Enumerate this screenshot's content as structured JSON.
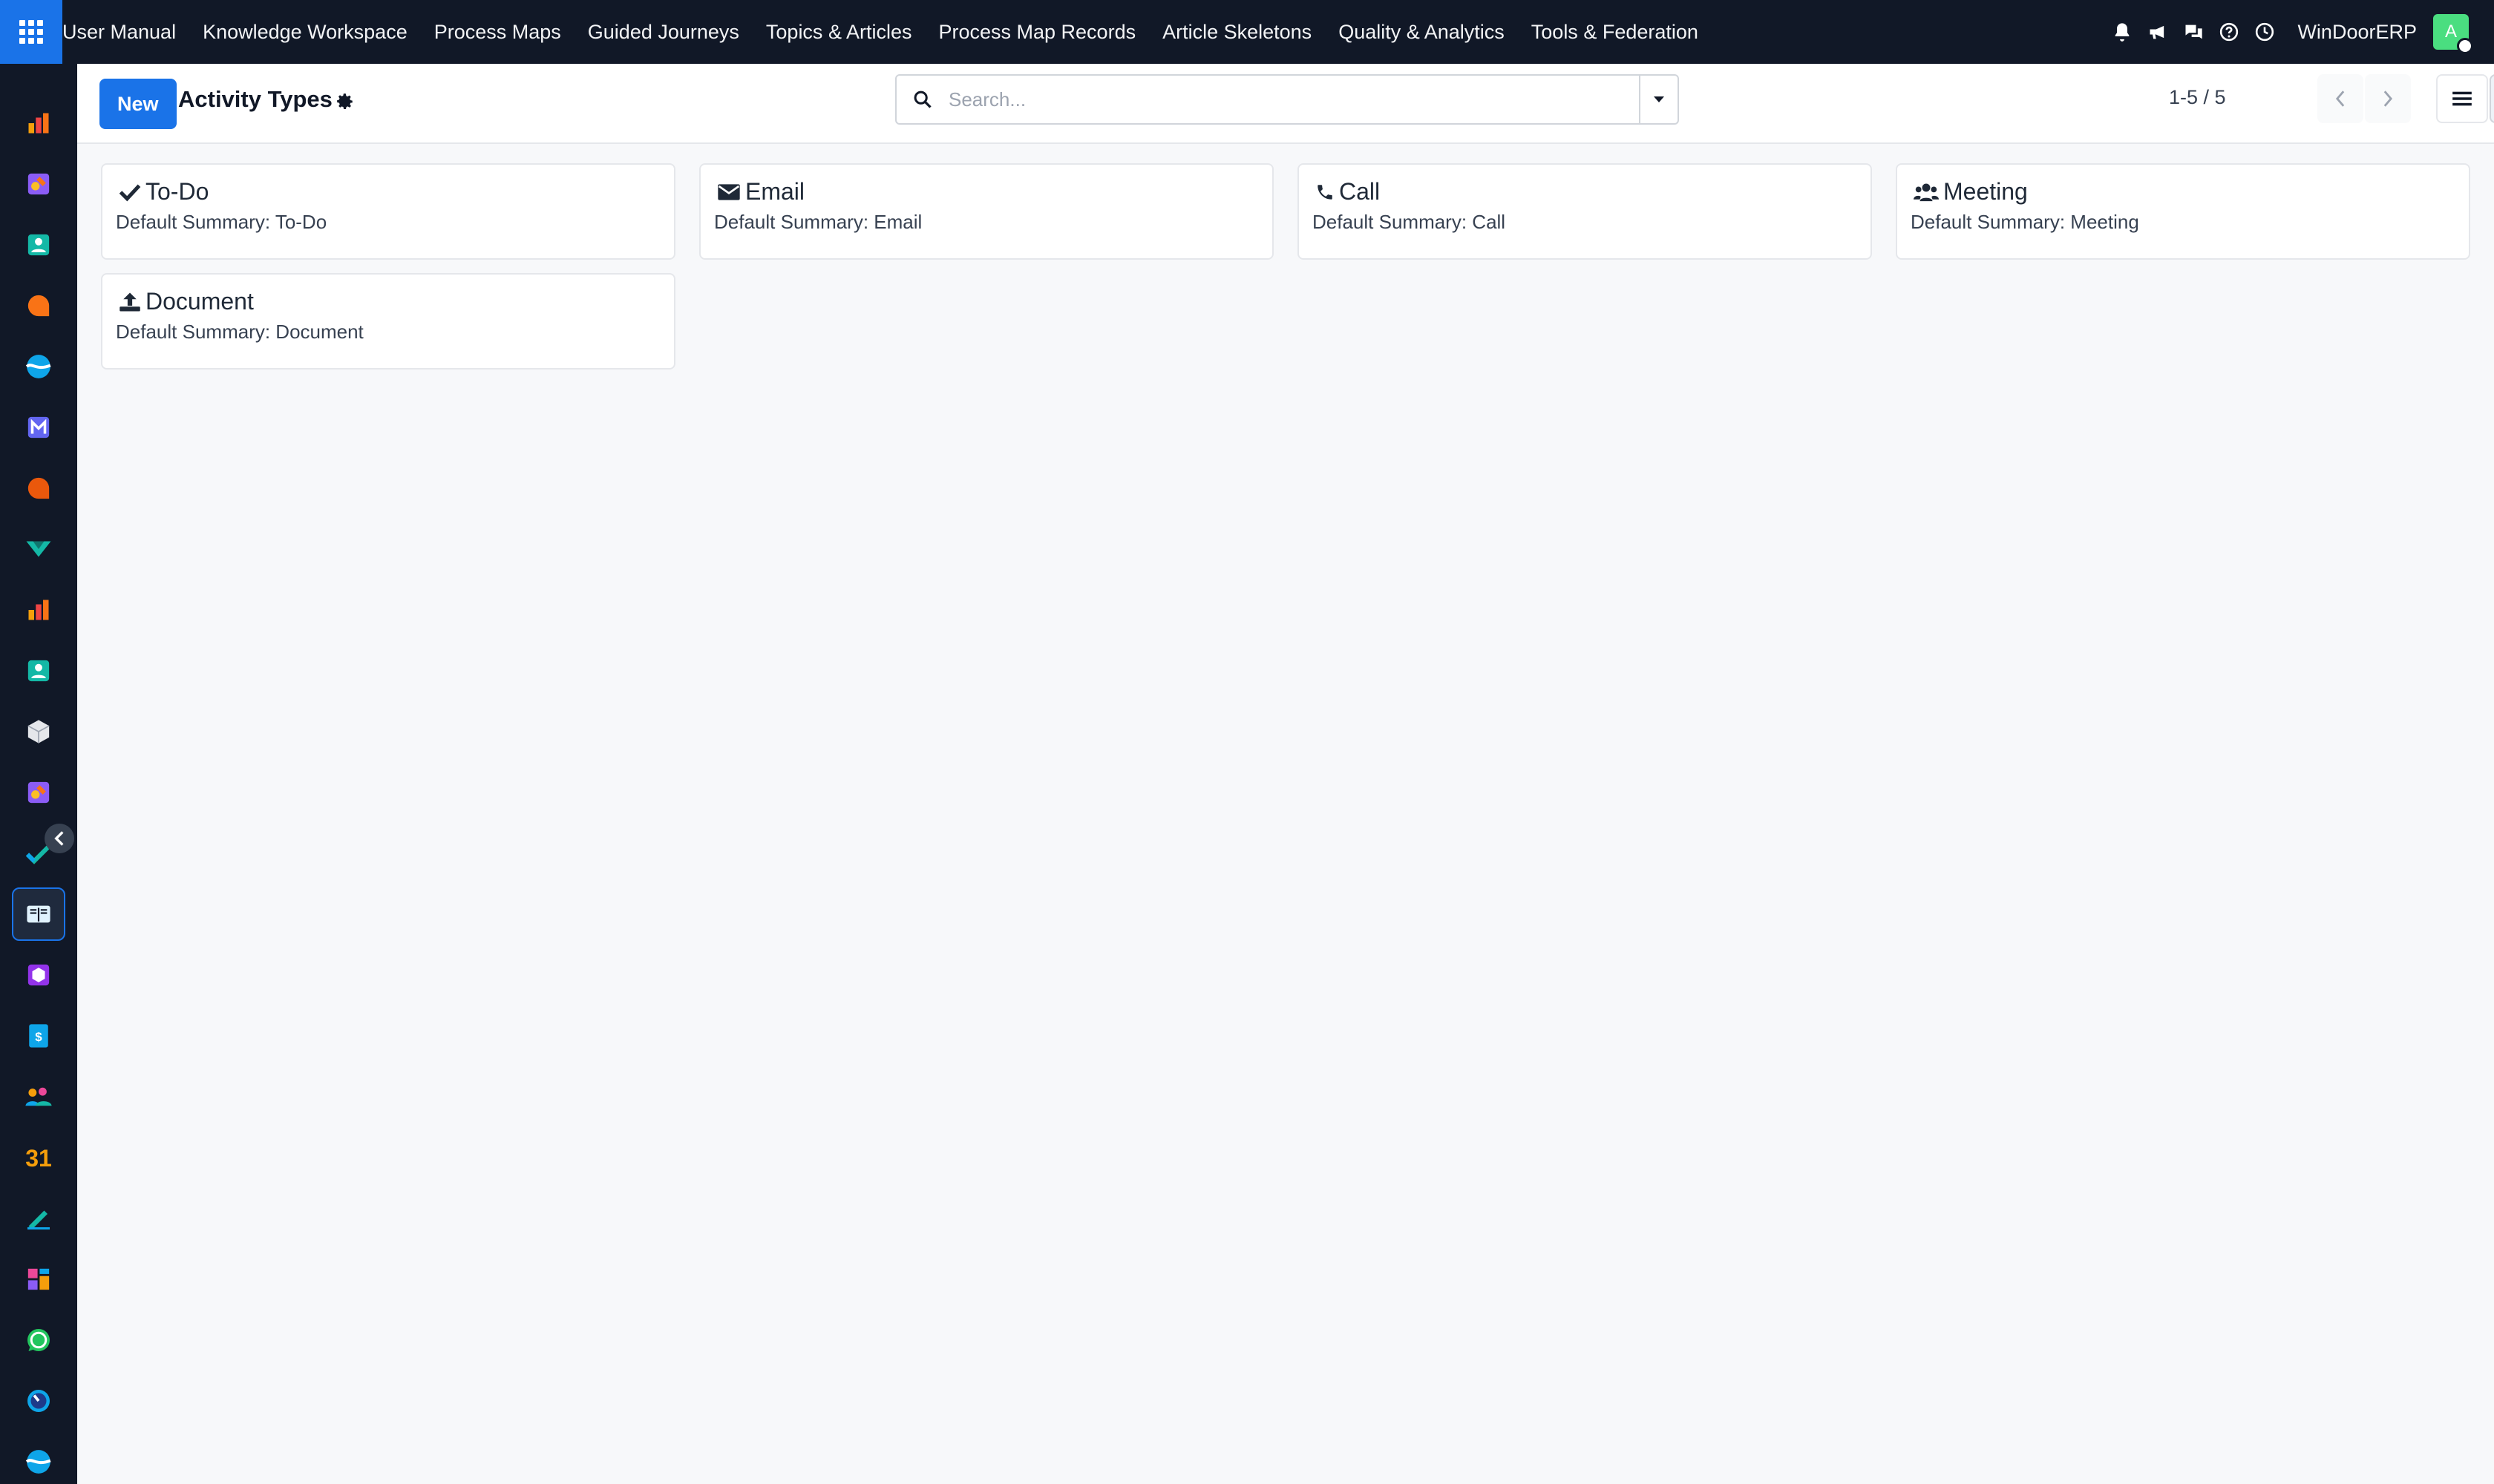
{
  "topbar": {
    "menu": [
      "User Manual",
      "Knowledge Workspace",
      "Process Maps",
      "Guided Journeys",
      "Topics & Articles",
      "Process Map Records",
      "Article Skeletons",
      "Quality & Analytics",
      "Tools & Federation"
    ],
    "company": "WinDoorERP",
    "avatar_letter": "A",
    "icons": [
      "bell-icon",
      "megaphone-icon",
      "chat-icon",
      "help-icon",
      "clock-icon"
    ]
  },
  "rail": {
    "apps": [
      "dashboard",
      "studio",
      "contacts",
      "discuss",
      "project",
      "mail",
      "livechat",
      "surveys",
      "reporting",
      "employees",
      "inventory",
      "knowledge-studio",
      "tasks",
      "knowledge",
      "products",
      "accounting",
      "team",
      "calendar",
      "sign",
      "dashboards",
      "whatsapp",
      "timer",
      "project-2"
    ],
    "active_app": "knowledge"
  },
  "control_panel": {
    "new_label": "New",
    "title": "Activity Types",
    "search_placeholder": "Search...",
    "pager": "1-5 / 5"
  },
  "cards": [
    {
      "title": "To-Do",
      "summary": "Default Summary: To-Do",
      "icon": "check-icon"
    },
    {
      "title": "Email",
      "summary": "Default Summary: Email",
      "icon": "envelope-icon"
    },
    {
      "title": "Call",
      "summary": "Default Summary: Call",
      "icon": "phone-icon"
    },
    {
      "title": "Meeting",
      "summary": "Default Summary: Meeting",
      "icon": "users-icon"
    },
    {
      "title": "Document",
      "summary": "Default Summary: Document",
      "icon": "upload-icon"
    }
  ],
  "colors": {
    "brand": "#1a73e8",
    "topbar": "#111827",
    "background": "#f7f8fa"
  }
}
